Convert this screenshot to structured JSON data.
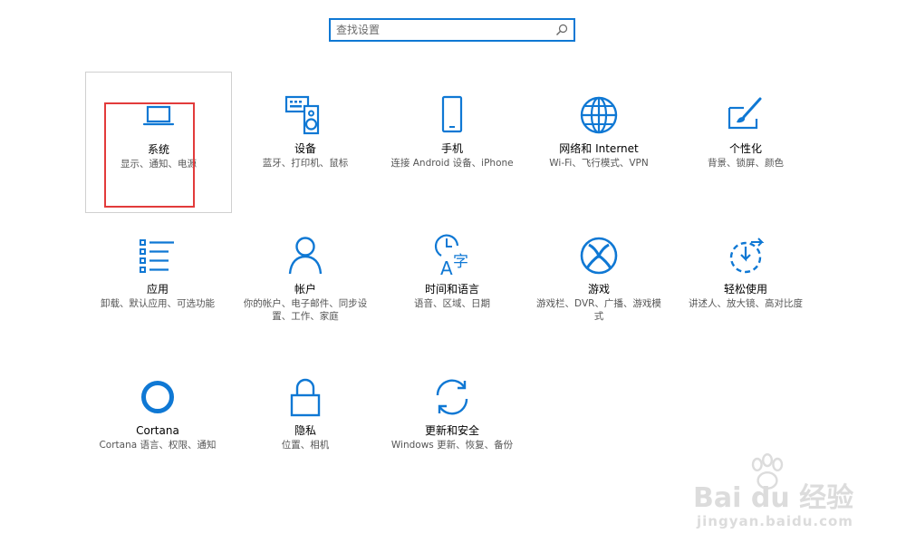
{
  "search": {
    "placeholder": "查找设置",
    "icon": "search-icon"
  },
  "tiles": [
    {
      "name": "系统",
      "desc": "显示、通知、电源",
      "icon": "laptop-icon"
    },
    {
      "name": "设备",
      "desc": "蓝牙、打印机、鼠标",
      "icon": "keyboard-speaker-icon"
    },
    {
      "name": "手机",
      "desc": "连接 Android 设备、iPhone",
      "icon": "phone-icon"
    },
    {
      "name": "网络和 Internet",
      "desc": "Wi-Fi、飞行模式、VPN",
      "icon": "globe-icon"
    },
    {
      "name": "个性化",
      "desc": "背景、锁屏、颜色",
      "icon": "paint-brush-icon"
    },
    {
      "name": "应用",
      "desc": "卸载、默认应用、可选功能",
      "icon": "apps-list-icon"
    },
    {
      "name": "帐户",
      "desc": "你的帐户、电子邮件、同步设置、工作、家庭",
      "icon": "person-icon"
    },
    {
      "name": "时间和语言",
      "desc": "语音、区域、日期",
      "icon": "time-language-icon"
    },
    {
      "name": "游戏",
      "desc": "游戏栏、DVR、广播、游戏模式",
      "icon": "xbox-icon"
    },
    {
      "name": "轻松使用",
      "desc": "讲述人、放大镜、高对比度",
      "icon": "ease-of-access-icon"
    },
    {
      "name": "Cortana",
      "desc": "Cortana 语言、权限、通知",
      "icon": "cortana-ring-icon"
    },
    {
      "name": "隐私",
      "desc": "位置、相机",
      "icon": "lock-icon"
    },
    {
      "name": "更新和安全",
      "desc": "Windows 更新、恢复、备份",
      "icon": "refresh-icon"
    }
  ],
  "watermark": {
    "brand": "Bai du 经验",
    "url": "jingyan.baidu.com"
  },
  "colors": {
    "accent": "#0f78d4",
    "highlight": "#e23b3b",
    "selected_border": "#d0d0d0"
  }
}
